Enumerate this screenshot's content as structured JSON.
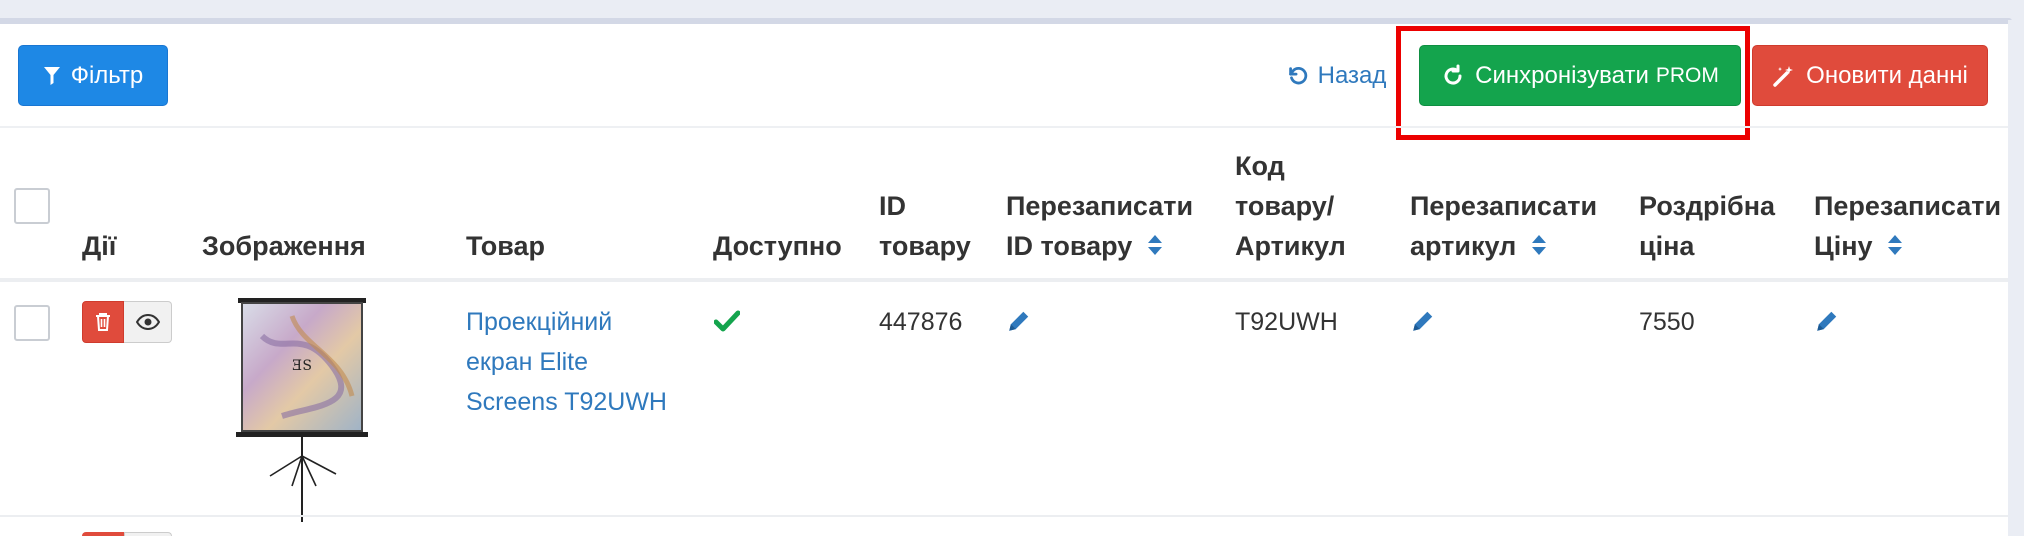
{
  "toolbar": {
    "filter_label": "Фільтр",
    "back_label": "Назад",
    "sync_label": "Синхронізувати",
    "sync_suffix": "PROM",
    "update_label": "Оновити данні"
  },
  "table": {
    "headers": {
      "actions": "Дії",
      "image": "Зображення",
      "product": "Товар",
      "available": "Доступно",
      "id_line1": "ID",
      "id_line2": "товару",
      "overwrite_id_line1": "Перезаписати",
      "overwrite_id_line2": "ID товару",
      "code_line1": "Код",
      "code_line2": "товару/",
      "code_line3": "Артикул",
      "overwrite_sku_line1": "Перезаписати",
      "overwrite_sku_line2": "артикул",
      "retail_line1": "Роздрібна",
      "retail_line2": "ціна",
      "overwrite_price_line1": "Перезаписати",
      "overwrite_price_line2": "Ціну"
    },
    "rows": [
      {
        "product_line1": "Проекційний",
        "product_line2": "екран Elite",
        "product_line3": "Screens T92UWH",
        "available": true,
        "id": "447876",
        "code": "T92UWH",
        "retail_price": "7550"
      }
    ]
  },
  "colors": {
    "primary": "#1e88e5",
    "success": "#14a44d",
    "danger": "#e04b3c",
    "link": "#2f79bd",
    "highlight": "#ec0000"
  },
  "icons": {
    "filter": "filter-icon",
    "back": "undo-icon",
    "sync": "refresh-icon",
    "update": "magic-wand-icon",
    "delete": "trash-icon",
    "view": "eye-icon",
    "available": "check-icon",
    "edit": "pencil-icon",
    "sort": "sort-icon"
  }
}
